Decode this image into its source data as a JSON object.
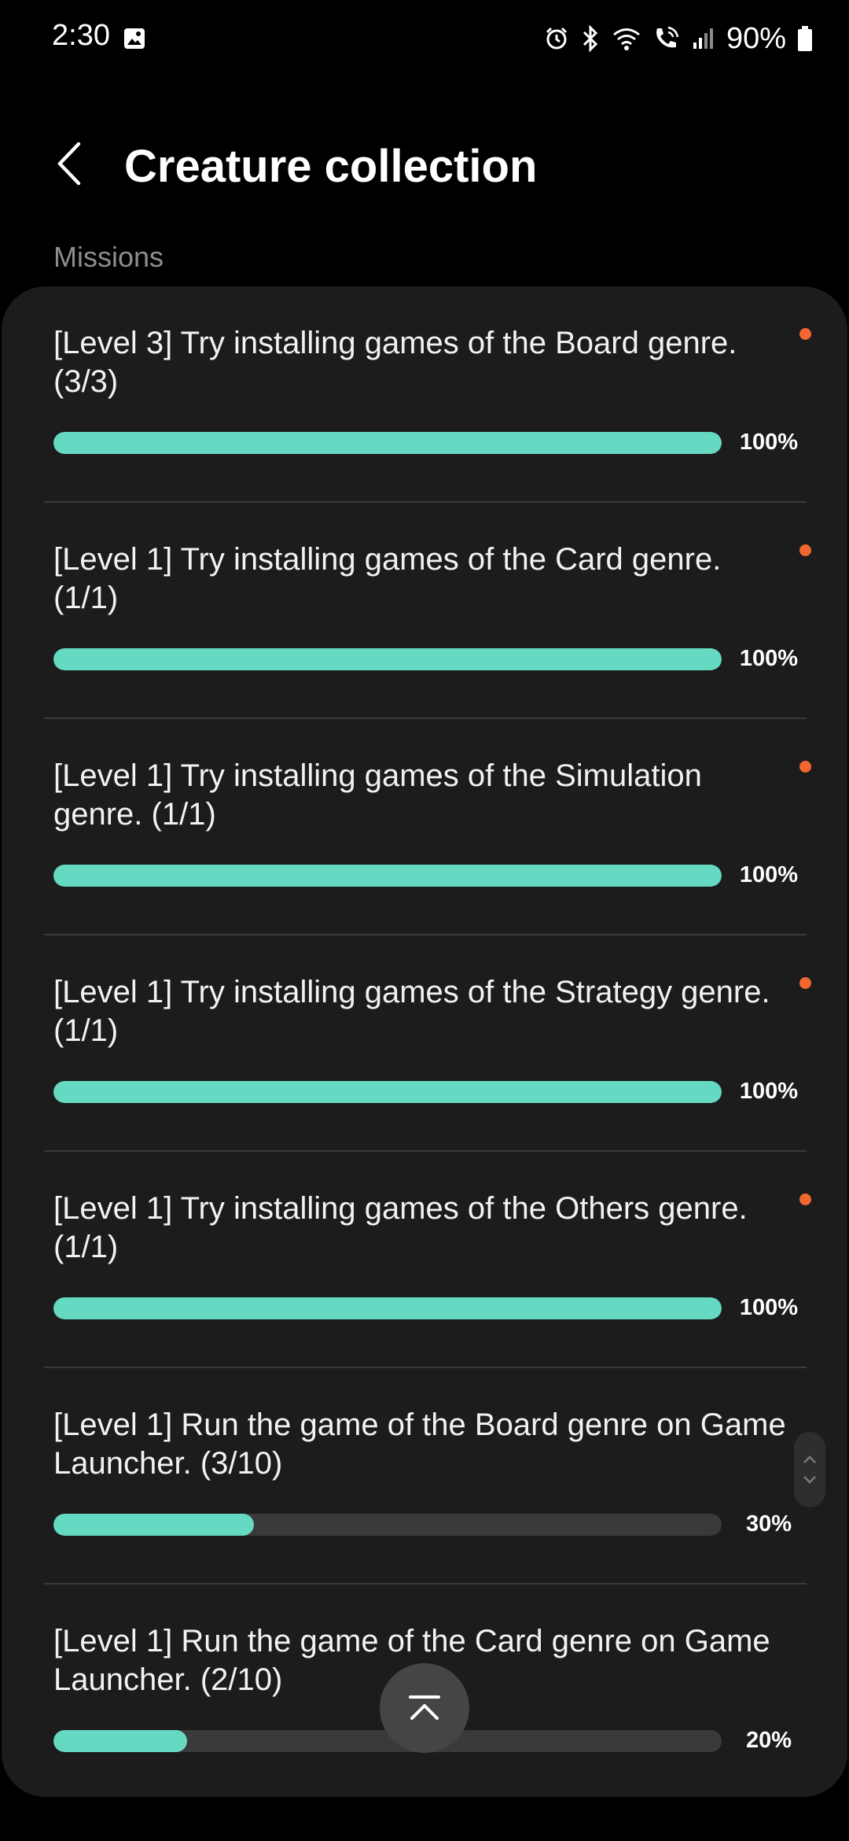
{
  "status_bar": {
    "time": "2:30",
    "battery_percent": "90%",
    "icons": [
      "gallery-icon",
      "alarm-icon",
      "bluetooth-icon",
      "wifi-icon",
      "wifi-calling-icon",
      "signal-icon",
      "battery-icon"
    ]
  },
  "header": {
    "title": "Creature collection",
    "back_icon": "back-arrow-icon"
  },
  "section": {
    "label": "Missions"
  },
  "missions": [
    {
      "title": "[Level 3]  Try installing games of the Board genre. (3/3)",
      "progress": 1.0,
      "progress_label": "100%",
      "new": true
    },
    {
      "title": "[Level 1]  Try installing games of the Card genre. (1/1)",
      "progress": 1.0,
      "progress_label": "100%",
      "new": true
    },
    {
      "title": "[Level 1]  Try installing games of the Simulation genre. (1/1)",
      "progress": 1.0,
      "progress_label": "100%",
      "new": true
    },
    {
      "title": "[Level 1]  Try installing games of the Strategy genre. (1/1)",
      "progress": 1.0,
      "progress_label": "100%",
      "new": true
    },
    {
      "title": "[Level 1]  Try installing games of the Others genre. (1/1)",
      "progress": 1.0,
      "progress_label": "100%",
      "new": true
    },
    {
      "title": "[Level 1]  Run the game of the Board genre on Game Launcher. (3/10)",
      "progress": 0.3,
      "progress_label": "30%",
      "new": false
    },
    {
      "title": "[Level 1]  Run the game of the Card genre on Game Launcher. (2/10)",
      "progress": 0.2,
      "progress_label": "20%",
      "new": false
    }
  ],
  "colors": {
    "progress_fill": "#66d9c3",
    "progress_track": "#3a3a3a",
    "new_dot": "#f2672f",
    "card_background": "#1c1c1c"
  },
  "controls": {
    "scroll_handle_icon": "scroll-handle-icon",
    "scroll_top_icon": "scroll-to-top-icon"
  }
}
